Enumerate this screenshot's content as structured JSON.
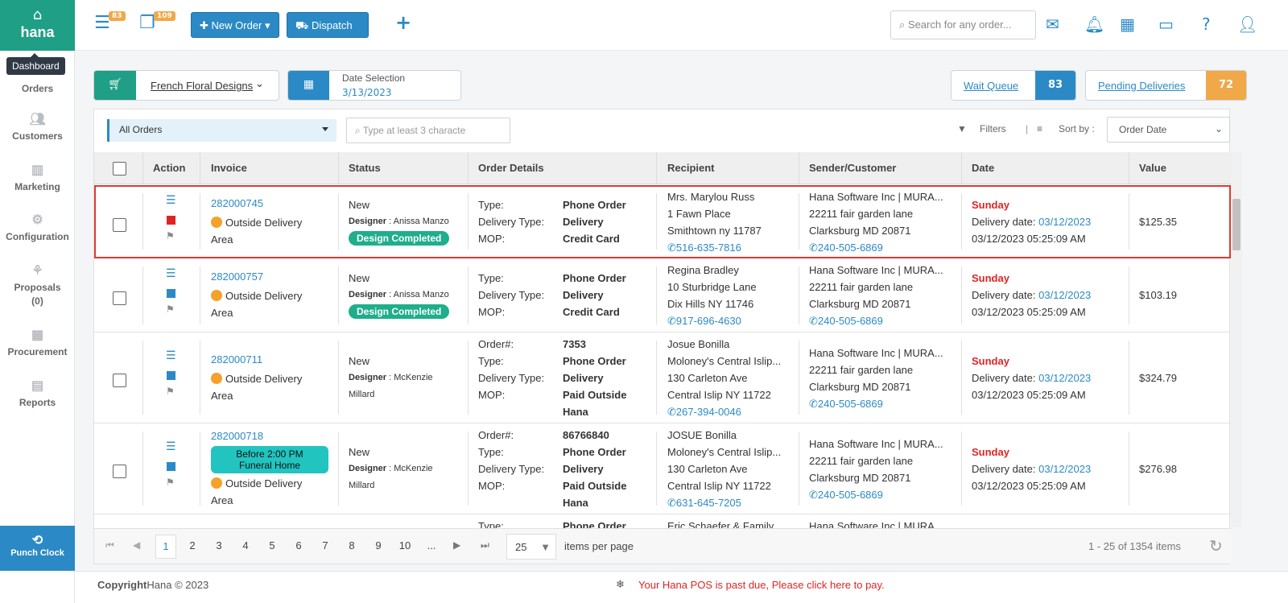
{
  "app": {
    "brand": "hana",
    "home_icon": "home-icon"
  },
  "sidebar": {
    "tooltip": "Dashboard",
    "items": [
      {
        "label": "Orders",
        "icon": "orders-icon"
      },
      {
        "label": "Customers",
        "icon": "users-icon"
      },
      {
        "label": "Marketing",
        "icon": "chart-icon"
      },
      {
        "label": "Configuration",
        "icon": "gear-icon"
      },
      {
        "label": "Proposals",
        "sub": "(0)",
        "icon": "proposal-icon"
      },
      {
        "label": "Procurement",
        "icon": "procurement-icon"
      },
      {
        "label": "Reports",
        "icon": "report-icon"
      }
    ],
    "punch_clock": "Punch Clock"
  },
  "topbar": {
    "badge1": "83",
    "badge2": "109",
    "new_order": "New Order",
    "dispatch": "Dispatch",
    "search_placeholder": "Search for any order..."
  },
  "filters": {
    "store": "French Floral Designs",
    "date_label": "Date Selection",
    "date_value": "3/13/2023",
    "wait_queue": "Wait Queue",
    "wait_queue_count": "83",
    "pending_deliveries": "Pending Deliveries",
    "pending_count": "72",
    "order_filter": "All Orders",
    "mini_search_placeholder": "Type at least 3 characte",
    "filters_label": "Filters",
    "sort_label": "Sort by :",
    "sort_value": "Order Date"
  },
  "table": {
    "headers": [
      "Action",
      "Invoice",
      "Status",
      "Order Details",
      "Recipient",
      "Sender/Customer",
      "Date",
      "Value"
    ],
    "rows": [
      {
        "invoice": "282000745",
        "area1": "Outside Delivery",
        "area2": "Area",
        "status": "New",
        "designer_label": "Designer",
        "designer": "Anissa Manzo",
        "badge": "Design Completed",
        "details": [
          [
            "Type:",
            "Phone Order"
          ],
          [
            "Delivery Type:",
            "Delivery"
          ],
          [
            "MOP:",
            "Credit Card"
          ]
        ],
        "recipient": [
          "Mrs. Marylou Russ",
          "1 Fawn Place",
          "Smithtown ny 11787"
        ],
        "recipient_phone": "516-635-7816",
        "sender": [
          "Hana Software Inc | MURA...",
          "22211 fair garden lane",
          "Clarksburg MD 20871"
        ],
        "sender_phone": "240-505-6869",
        "day": "Sunday",
        "delivery_label": "Delivery date:",
        "delivery_date": "03/12/2023",
        "timestamp": "03/12/2023 05:25:09 AM",
        "value": "$125.35"
      },
      {
        "invoice": "282000757",
        "area1": "Outside Delivery",
        "area2": "Area",
        "status": "New",
        "designer_label": "Designer",
        "designer": "Anissa Manzo",
        "badge": "Design Completed",
        "details": [
          [
            "Type:",
            "Phone Order"
          ],
          [
            "Delivery Type:",
            "Delivery"
          ],
          [
            "MOP:",
            "Credit Card"
          ]
        ],
        "recipient": [
          "Regina Bradley",
          "10 Sturbridge Lane",
          "Dix Hills NY 11746"
        ],
        "recipient_phone": "917-696-4630",
        "sender": [
          "Hana Software Inc | MURA...",
          "22211 fair garden lane",
          "Clarksburg MD 20871"
        ],
        "sender_phone": "240-505-6869",
        "day": "Sunday",
        "delivery_label": "Delivery date:",
        "delivery_date": "03/12/2023",
        "timestamp": "03/12/2023 05:25:09 AM",
        "value": "$103.19"
      },
      {
        "invoice": "282000711",
        "area1": "Outside Delivery",
        "area2": "Area",
        "status": "New",
        "designer_label": "Designer",
        "designer": "McKenzie",
        "designer2": "Millard",
        "details": [
          [
            "Order#:",
            "7353"
          ],
          [
            "Type:",
            "Phone Order"
          ],
          [
            "Delivery Type:",
            "Delivery"
          ],
          [
            "MOP:",
            "Paid Outside"
          ],
          [
            "",
            "Hana"
          ]
        ],
        "recipient": [
          "Josue Bonilla",
          "Moloney's Central Islip...",
          "130 Carleton Ave",
          "Central Islip NY 11722"
        ],
        "recipient_phone": "267-394-0046",
        "sender": [
          "Hana Software Inc | MURA...",
          "22211 fair garden lane",
          "Clarksburg MD 20871"
        ],
        "sender_phone": "240-505-6869",
        "day": "Sunday",
        "delivery_label": "Delivery date:",
        "delivery_date": "03/12/2023",
        "timestamp": "03/12/2023 05:25:09 AM",
        "value": "$324.79"
      },
      {
        "invoice": "282000718",
        "tag1": "Before 2:00 PM",
        "tag2": "Funeral Home",
        "area1": "Outside Delivery",
        "area2": "Area",
        "status": "New",
        "designer_label": "Designer",
        "designer": "McKenzie",
        "designer2": "Millard",
        "details": [
          [
            "Order#:",
            "86766840"
          ],
          [
            "Type:",
            "Phone Order"
          ],
          [
            "Delivery Type:",
            "Delivery"
          ],
          [
            "MOP:",
            "Paid Outside"
          ],
          [
            "",
            "Hana"
          ]
        ],
        "recipient": [
          "JOSUE Bonilla",
          "Moloney's Central Islip...",
          "130 Carleton Ave",
          "Central Islip NY 11722"
        ],
        "recipient_phone": "631-645-7205",
        "sender": [
          "Hana Software Inc | MURA...",
          "22211 fair garden lane",
          "Clarksburg MD 20871"
        ],
        "sender_phone": "240-505-6869",
        "day": "Sunday",
        "delivery_label": "Delivery date:",
        "delivery_date": "03/12/2023",
        "timestamp": "03/12/2023 05:25:09 AM",
        "value": "$276.98"
      }
    ],
    "partial_row": {
      "type": "Type:",
      "type_val": "Phone Order",
      "recipient": "Eric Schaefer & Family",
      "sender": "Hana Software Inc | MURA..."
    }
  },
  "pager": {
    "pages": [
      "1",
      "2",
      "3",
      "4",
      "5",
      "6",
      "7",
      "8",
      "9",
      "10",
      "..."
    ],
    "per_page": "25",
    "per_page_label": "items per page",
    "summary": "1 - 25 of 1354 items"
  },
  "footer": {
    "copyright_bold": "Copyright",
    "copyright": "Hana © 2023",
    "notice": "Your Hana POS is past due, Please click here to pay."
  },
  "colors": {
    "green": "#1f9f85",
    "blue": "#2b8ac6",
    "orange": "#f0a848",
    "red": "#e02424"
  }
}
